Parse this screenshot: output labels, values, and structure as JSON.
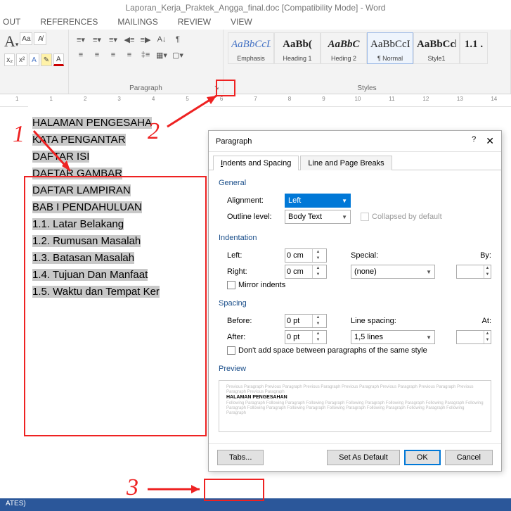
{
  "app": {
    "title": "Laporan_Kerja_Praktek_Angga_final.doc [Compatibility Mode] - Word"
  },
  "tabs": [
    "OUT",
    "REFERENCES",
    "MAILINGS",
    "REVIEW",
    "VIEW"
  ],
  "groups": {
    "paragraph": "Paragraph",
    "styles": "Styles"
  },
  "styles": [
    {
      "preview": "AaBbCcL",
      "name": "Emphasis"
    },
    {
      "preview": "AaBb(",
      "name": "Heading 1"
    },
    {
      "preview": "AaBbC",
      "name": "Heding 2"
    },
    {
      "preview": "AaBbCcI",
      "name": "¶ Normal"
    },
    {
      "preview": "AaBbCcl",
      "name": "Style1"
    },
    {
      "preview": "1.1 .",
      "name": ""
    }
  ],
  "ruler": [
    "1",
    "",
    "1",
    "",
    "2",
    "",
    "3",
    "",
    "4",
    "",
    "5",
    "",
    "6",
    "",
    "7",
    "",
    "8",
    "",
    "9",
    "",
    "10",
    "",
    "11",
    "",
    "12",
    "",
    "13",
    "",
    "14"
  ],
  "doc": [
    "HALAMAN PENGESAHA",
    "KATA PENGANTAR",
    "DAFTAR ISI",
    "DAFTAR GAMBAR",
    "DAFTAR LAMPIRAN",
    "BAB I   PENDAHULUAN",
    "1.1. Latar Belakang",
    "1.2. Rumusan Masalah",
    "1.3. Batasan Masalah",
    "1.4. Tujuan Dan Manfaat",
    "1.5. Waktu dan Tempat Ker"
  ],
  "dlg": {
    "title": "Paragraph",
    "help": "?",
    "tab1": "Indents and Spacing",
    "tab2": "Line and Page Breaks",
    "general": "General",
    "alignment_l": "Alignment:",
    "alignment_v": "Left",
    "outline_l": "Outline level:",
    "outline_v": "Body Text",
    "collapsed": "Collapsed by default",
    "indentation": "Indentation",
    "left_l": "Left:",
    "left_v": "0 cm",
    "right_l": "Right:",
    "right_v": "0 cm",
    "special_l": "Special:",
    "special_v": "(none)",
    "by_l": "By:",
    "by_v": "",
    "mirror": "Mirror indents",
    "spacing": "Spacing",
    "before_l": "Before:",
    "before_v": "0 pt",
    "after_l": "After:",
    "after_v": "0 pt",
    "linesp_l": "Line spacing:",
    "linesp_v": "1,5 lines",
    "at_l": "At:",
    "at_v": "",
    "noadd": "Don't add space between paragraphs of the same style",
    "preview_l": "Preview",
    "preview_bold": "HALAMAN PENGESAHAN",
    "btn_tabs": "Tabs...",
    "btn_default": "Set As Default",
    "btn_ok": "OK",
    "btn_cancel": "Cancel"
  },
  "status": "ATES)",
  "ann": {
    "n1": "1",
    "n2": "2",
    "n3": "3"
  }
}
